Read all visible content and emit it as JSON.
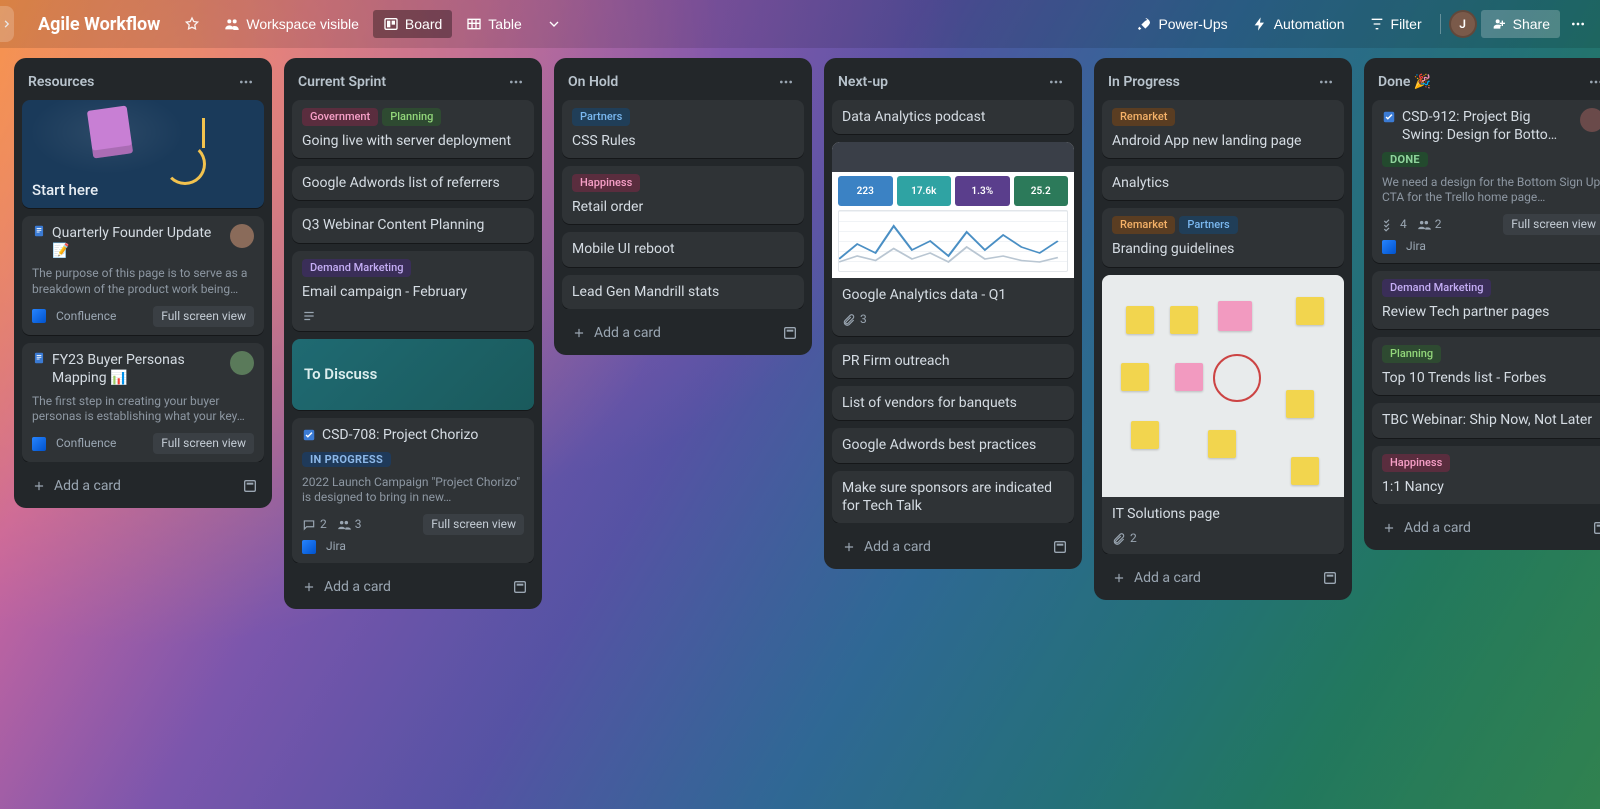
{
  "header": {
    "board_name": "Agile Workflow",
    "workspace_visible": "Workspace visible",
    "view_board": "Board",
    "view_table": "Table",
    "powerups": "Power-Ups",
    "automation": "Automation",
    "filter": "Filter",
    "share": "Share",
    "avatar_initial": "J"
  },
  "ui": {
    "add_card": "Add a card",
    "full_screen": "Full screen view",
    "confluence": "Confluence",
    "jira": "Jira"
  },
  "labels": {
    "government": "Government",
    "planning": "Planning",
    "demand_marketing": "Demand Marketing",
    "partners": "Partners",
    "happiness": "Happiness",
    "remarket": "Remarket"
  },
  "status": {
    "in_progress": "IN PROGRESS",
    "done": "DONE"
  },
  "lists": {
    "resources": {
      "title": "Resources",
      "start_here": "Start here",
      "card1": {
        "title": "Quarterly Founder Update 📝",
        "desc": "The purpose of this page is to serve as a breakdown of the product work being…"
      },
      "card2": {
        "title": "FY23 Buyer Personas Mapping 📊",
        "desc": "The first step in creating your buyer personas is establishing what your key…"
      }
    },
    "current": {
      "title": "Current Sprint",
      "c1": "Going live with server deployment",
      "c2": "Google Adwords list of referrers",
      "c3": "Q3 Webinar Content Planning",
      "c4": "Email campaign - February",
      "discuss": "To Discuss",
      "c5": {
        "title": "CSD-708: Project Chorizo",
        "desc": "2022 Launch Campaign \"Project Chorizo\" is designed to bring in new…",
        "comments": "2",
        "members": "3"
      }
    },
    "onhold": {
      "title": "On Hold",
      "c1": "CSS Rules",
      "c2": "Retail order",
      "c3": "Mobile UI reboot",
      "c4": "Lead Gen Mandrill stats"
    },
    "nextup": {
      "title": "Next-up",
      "c1": "Data Analytics podcast",
      "chart": {
        "a": "223",
        "b": "17.6k",
        "c": "1.3%",
        "d": "25.2"
      },
      "c2_title": "Google Analytics data - Q1",
      "c2_att": "3",
      "c3": "PR Firm outreach",
      "c4": "List of vendors for banquets",
      "c5": "Google Adwords best practices",
      "c6": "Make sure sponsors are indicated for Tech Talk"
    },
    "inprogress": {
      "title": "In Progress",
      "c1": "Android App new landing page",
      "c2": "Analytics",
      "c3": "Branding guidelines",
      "c4_title": "IT Solutions page",
      "c4_att": "2"
    },
    "done": {
      "title": "Done 🎉",
      "c1": {
        "title": "CSD-912: Project Big Swing: Design for Botto…",
        "desc": "We need a design for the Bottom Sign Up CTA for the Trello home page…",
        "checks": "4",
        "members": "2"
      },
      "c2": "Review Tech partner pages",
      "c3": "Top 10 Trends list - Forbes",
      "c4": "TBC Webinar: Ship Now, Not Later",
      "c5": "1:1 Nancy"
    }
  }
}
